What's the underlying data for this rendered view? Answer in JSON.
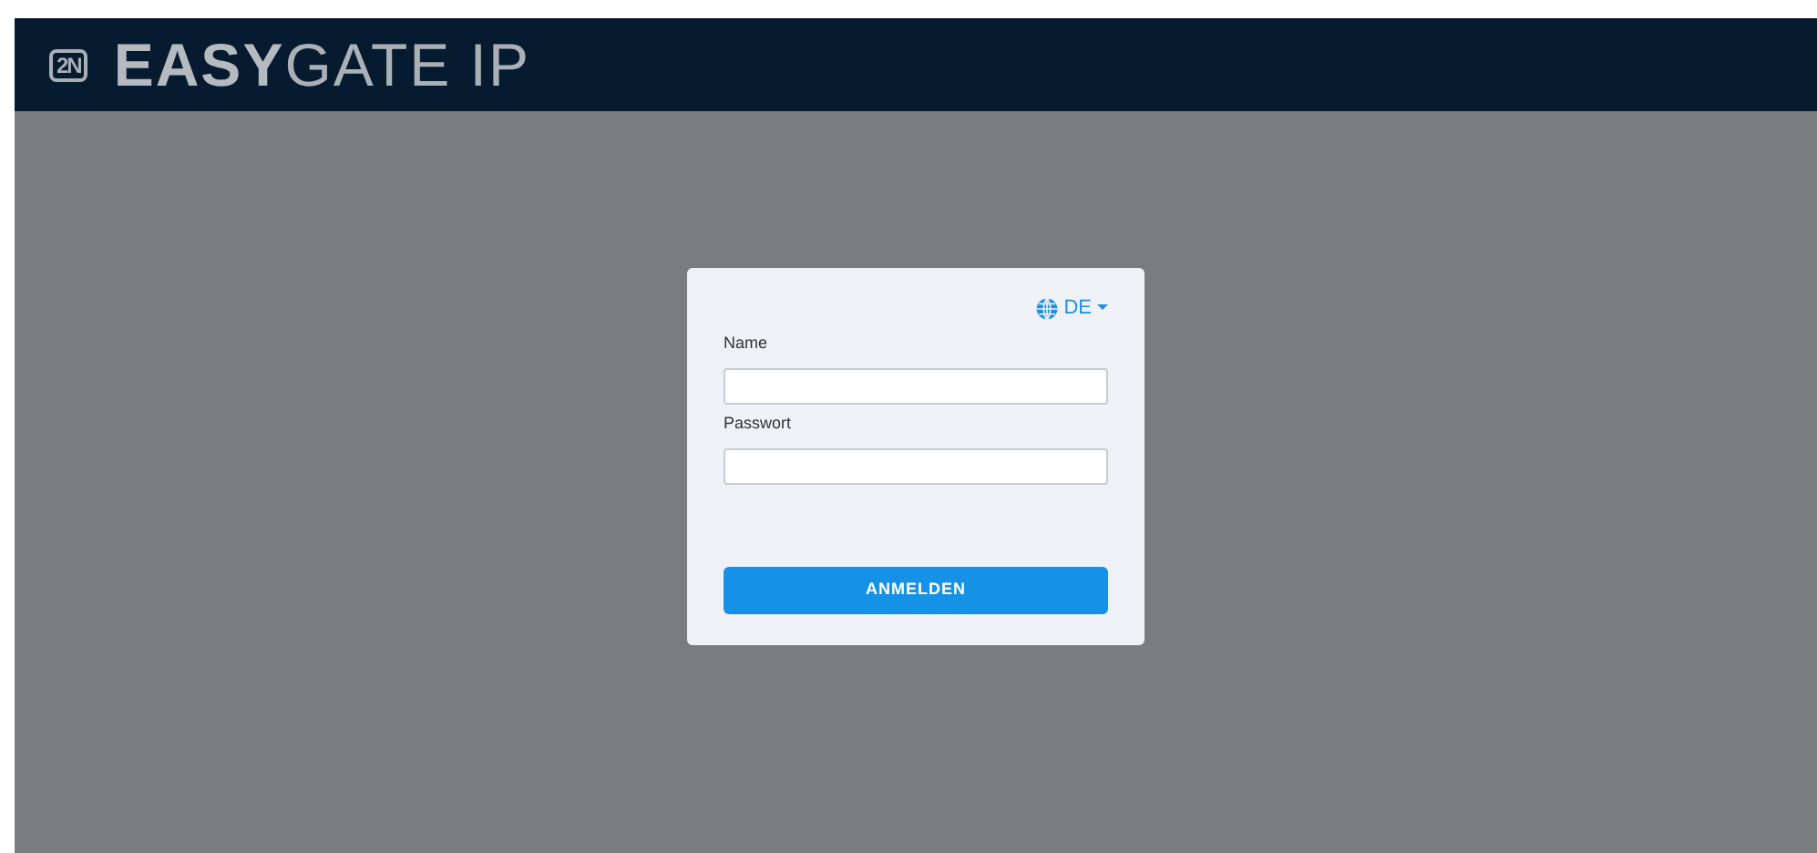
{
  "header": {
    "logo": "2N",
    "title": "**EASY**GATE IP"
  },
  "login": {
    "language": "DE",
    "fields": [
      {
        "label": "Name"
      },
      {
        "label": "Passwort"
      }
    ],
    "button": "ANMELDEN"
  }
}
